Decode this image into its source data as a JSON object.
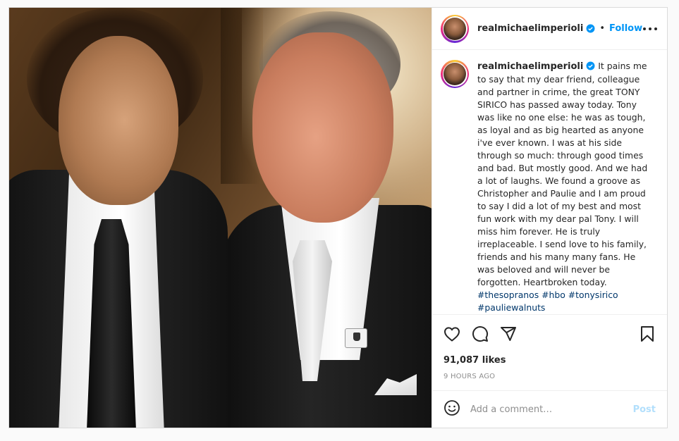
{
  "post": {
    "username": "realmichaelimperioli",
    "follow_label": "Follow",
    "separator": "•",
    "caption": "It pains me to say that my dear friend, colleague and partner in crime, the great TONY SIRICO has passed away today. Tony was like no one else: he was as tough, as loyal and as big hearted as anyone i've ever known. I was at his side through so much: through good times and bad. But mostly good. And we had a lot of laughs. We found a groove as Christopher and Paulie and I am proud to say I did a lot of my best and most fun work with my dear pal Tony. I will miss him forever. He is truly irreplaceable. I send love to his family, friends and his many many fans. He was beloved and will never be forgotten. Heartbroken today.",
    "hashtags": [
      "#thesopranos",
      "#hbo",
      "#tonysirico",
      "#pauliewalnuts"
    ],
    "likes": "91,087 likes",
    "time": "9 HOURS AGO",
    "comment_placeholder": "Add a comment…",
    "post_label": "Post"
  },
  "icons": {
    "verified": "verified-badge-icon",
    "more": "more-options-icon",
    "like": "heart-icon",
    "comment": "comment-icon",
    "share": "share-icon",
    "save": "bookmark-icon",
    "emoji": "emoji-icon"
  },
  "colors": {
    "accent": "#0095f6",
    "hashtag": "#00376b",
    "post_disabled": "#b2dffc",
    "muted": "#8e8e8e"
  }
}
